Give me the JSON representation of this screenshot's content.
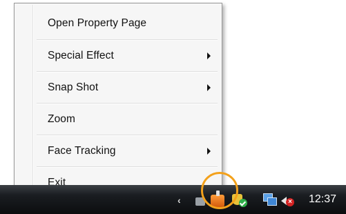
{
  "context_menu": {
    "items": [
      {
        "label": "Open Property Page",
        "has_submenu": false
      },
      {
        "label": "Special Effect",
        "has_submenu": true
      },
      {
        "label": "Snap Shot",
        "has_submenu": true
      },
      {
        "label": "Zoom",
        "has_submenu": false
      },
      {
        "label": "Face Tracking",
        "has_submenu": true
      },
      {
        "label": "Exit",
        "has_submenu": false
      }
    ]
  },
  "taskbar": {
    "clock": "12:37",
    "tray_icons": [
      "show-hidden-icons-chevron",
      "tray-app-icon",
      "webcam-icon",
      "security-shield-icon",
      "network-icon",
      "volume-muted-icon"
    ]
  },
  "colors": {
    "highlight_ring": "#f3a11b",
    "taskbar": "#0c0d0f",
    "menu_bg": "#f6f6f6"
  }
}
